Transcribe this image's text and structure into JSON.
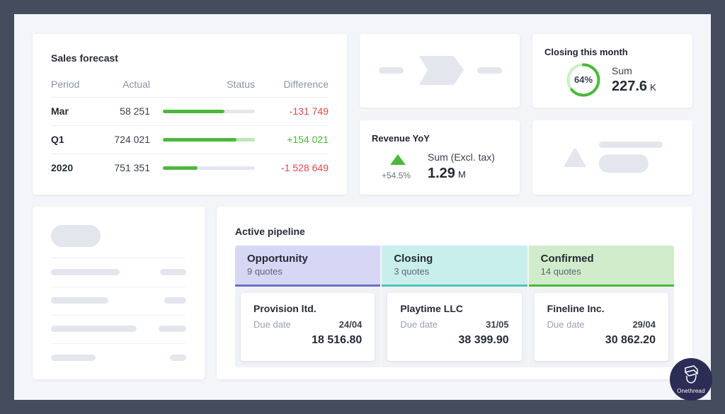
{
  "sales_forecast": {
    "title": "Sales forecast",
    "columns": [
      "Period",
      "Actual",
      "Status",
      "Difference"
    ],
    "rows": [
      {
        "period": "Mar",
        "actual": "58 251",
        "status_progress": 0.67,
        "exceeded": false,
        "difference": "-131 749",
        "trend": "negative"
      },
      {
        "period": "Q1",
        "actual": "724 021",
        "status_progress": 0.8,
        "exceeded": true,
        "difference": "+154 021",
        "trend": "positive"
      },
      {
        "period": "2020",
        "actual": "751 351",
        "status_progress": 0.38,
        "exceeded": false,
        "difference": "-1 528 649",
        "trend": "negative"
      }
    ]
  },
  "closing_this_month": {
    "title": "Closing this month",
    "progress_percent": 64,
    "progress_label": "64%",
    "sum_label": "Sum",
    "sum_value": "227.6",
    "sum_unit": "K"
  },
  "revenue_yoy": {
    "title": "Revenue YoY",
    "trend_icon": "triangle-up-icon",
    "change": "+54.5%",
    "sum_label": "Sum (Excl. tax)",
    "sum_value": "1.29",
    "sum_unit": "M"
  },
  "active_pipeline": {
    "title": "Active pipeline",
    "columns": [
      {
        "name": "Opportunity",
        "count": "9 quotes",
        "color": "#d5d7f5",
        "accent": "#6a6fc7",
        "deal": {
          "company": "Provision ltd.",
          "due_label": "Due date",
          "due_date": "24/04",
          "amount": "18 516.80"
        }
      },
      {
        "name": "Closing",
        "count": "3 quotes",
        "color": "#c9efec",
        "accent": "#4cc3b9",
        "deal": {
          "company": "Playtime LLC",
          "due_label": "Due date",
          "due_date": "31/05",
          "amount": "38 399.90"
        }
      },
      {
        "name": "Confirmed",
        "count": "14 quotes",
        "color": "#d0ecca",
        "accent": "#4cb83c",
        "deal": {
          "company": "Fineline Inc.",
          "due_label": "Due date",
          "due_date": "29/04",
          "amount": "30 862.20"
        }
      }
    ]
  },
  "branding": {
    "logo_text": "Onethread"
  },
  "colors": {
    "positive": "#4cb83c",
    "negative": "#e04848",
    "frame": "#444c5e",
    "skeleton": "#e4e6ee"
  }
}
